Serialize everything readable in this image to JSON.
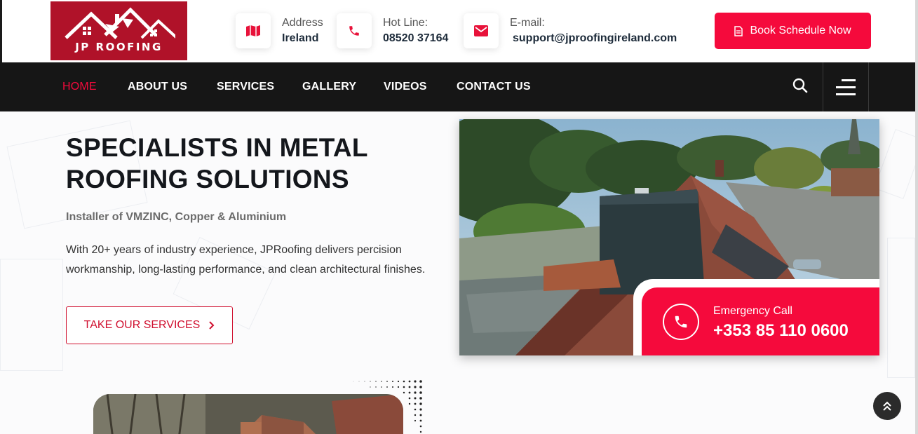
{
  "header": {
    "logo_text": "JP ROOFING",
    "address": {
      "label": "Address",
      "value": "Ireland",
      "icon": "map-icon"
    },
    "hotline": {
      "label": "Hot Line:",
      "value": "08520 37164",
      "icon": "phone-icon"
    },
    "email": {
      "label": "E-mail:",
      "value": "support@jproofingireland.com",
      "icon": "envelope-icon"
    },
    "book_button": "Book Schedule Now"
  },
  "nav": {
    "items": [
      {
        "label": "HOME",
        "active": true
      },
      {
        "label": "ABOUT US"
      },
      {
        "label": "SERVICES"
      },
      {
        "label": "GALLERY"
      },
      {
        "label": "VIDEOS"
      },
      {
        "label": "CONTACT US"
      }
    ]
  },
  "hero": {
    "title": "SPECIALISTS IN METAL ROOFING SOLUTIONS",
    "subtitle": "Installer of VMZINC, Copper & Aluminium",
    "description": "With 20+ years of industry experience, JPRoofing delivers percision workmanship, long-lasting performance, and clean architectural finishes.",
    "cta": "TAKE OUR SERVICES"
  },
  "emergency": {
    "label": "Emergency Call",
    "phone": "+353 85 110 0600"
  },
  "colors": {
    "brand_red": "#f50a3c",
    "logo_red": "#b01229",
    "nav_bg": "#161616"
  }
}
